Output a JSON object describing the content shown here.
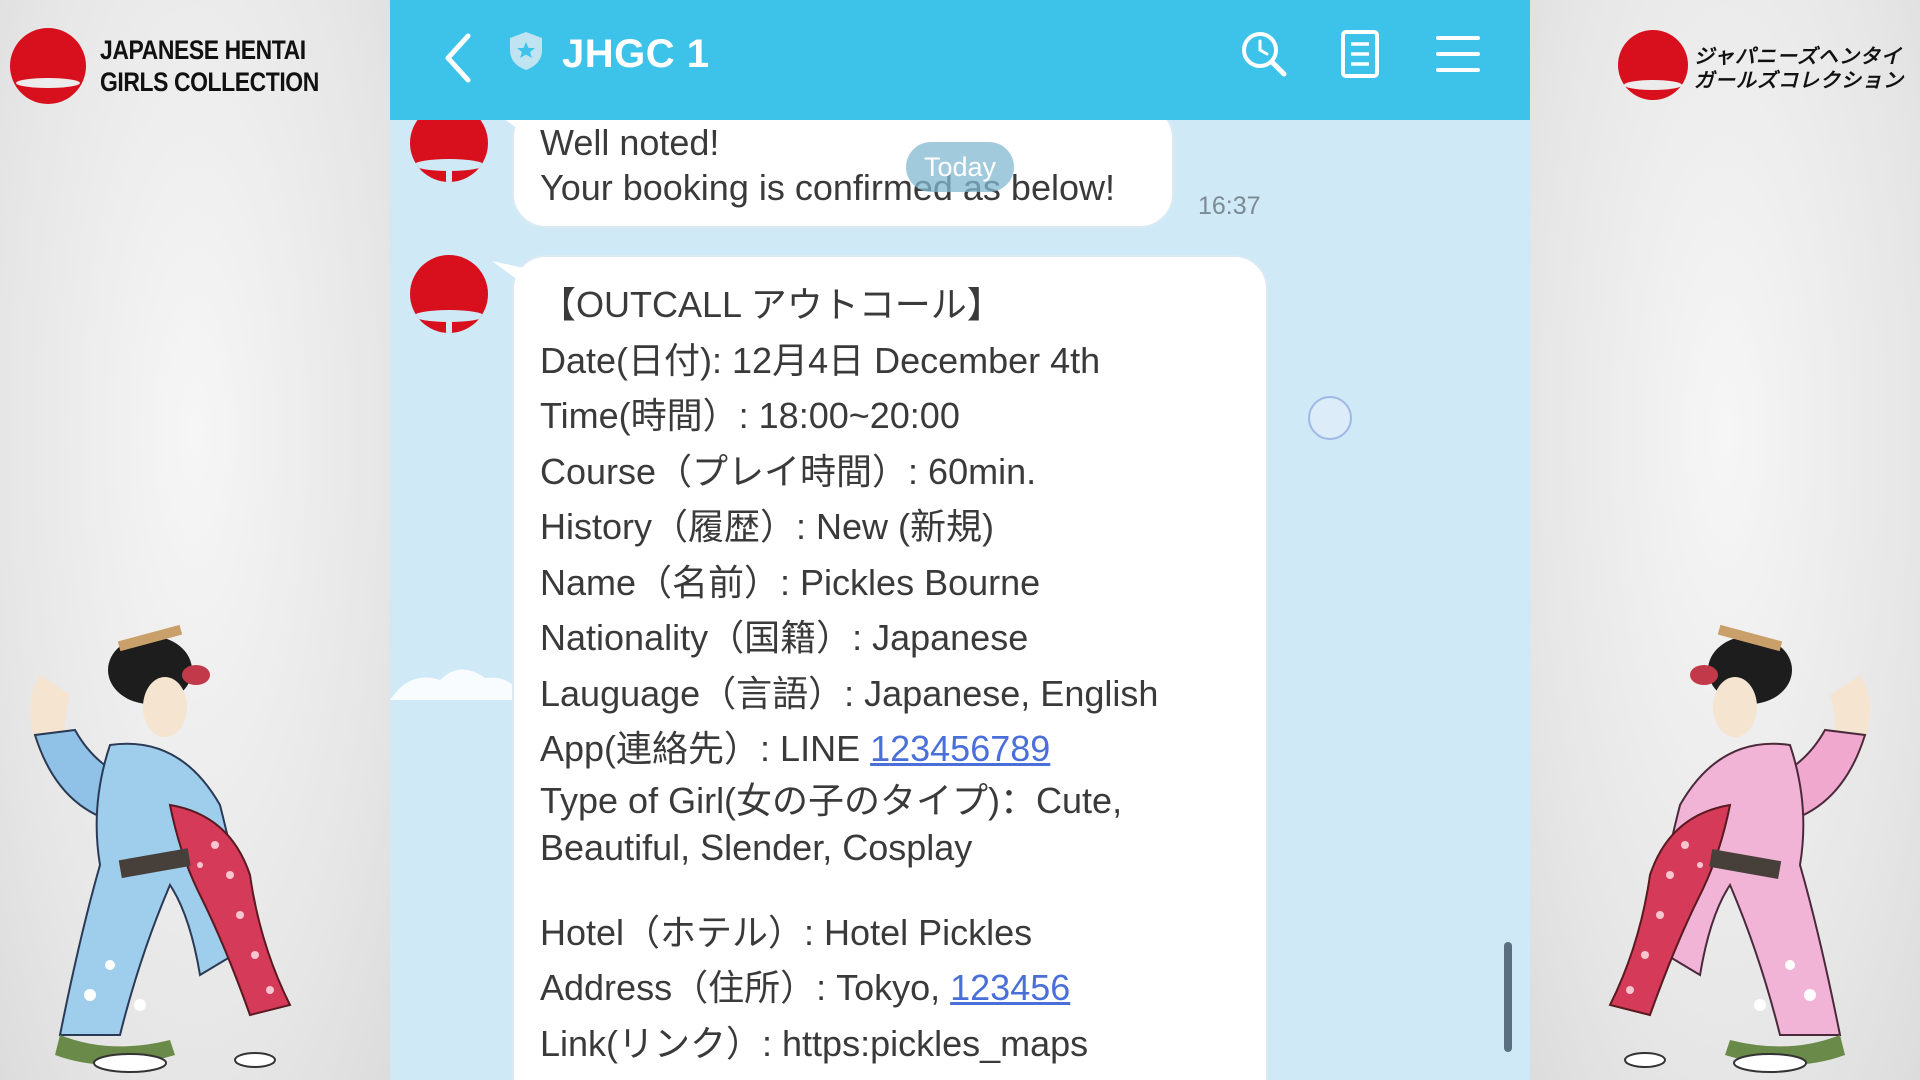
{
  "brand": {
    "name_en": "JAPANESE HENTAI\nGIRLS COLLECTION",
    "name_en_line1": "JAPANESE HENTAI",
    "name_en_line2": "GIRLS COLLECTION",
    "name_jp_line1": "ジャパニーズヘンタイ",
    "name_jp_line2": "ガールズコレクション"
  },
  "header": {
    "title": "JHGC 1",
    "icons": [
      "back-icon",
      "shield-icon",
      "search-icon",
      "notes-icon",
      "menu-icon"
    ]
  },
  "colors": {
    "header_bg": "#3dc3ea",
    "chat_bg": "#cfe9f7",
    "brand_red": "#d8101d",
    "link": "#4a6fd8"
  },
  "chat": {
    "date_pill": "Today",
    "messages": [
      {
        "lines": [
          "Well noted!",
          "Your booking is confirmed as below!"
        ],
        "time": "16:37"
      },
      {
        "rows": {
          "heading": "【OUTCALL アウトコール】",
          "date": "Date(日付): 12月4日 December 4th",
          "time": "Time(時間）: 18:00~20:00",
          "course": "Course（プレイ時間）: 60min.",
          "history": "History（履歴）: New (新規)",
          "name": "Name（名前）: Pickles Bourne",
          "nationality": "Nationality（国籍）: Japanese",
          "language": "Lauguage（言語）: Japanese, English",
          "app_prefix": "App(連絡先）: LINE ",
          "app_link": "123456789",
          "type_of_girl": "Type of Girl(女の子のタイプ)：Cute, Beautiful, Slender, Cosplay",
          "hotel": "Hotel（ホテル）: Hotel Pickles",
          "address_prefix": "Address（住所）: Tokyo, ",
          "address_link": "123456",
          "link": "Link(リンク）: https:pickles_maps"
        }
      }
    ]
  }
}
